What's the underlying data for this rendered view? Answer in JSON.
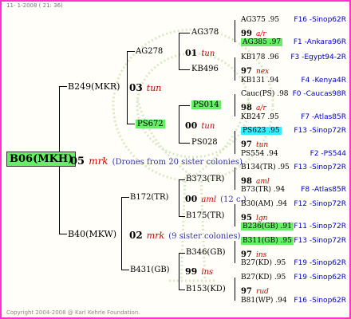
{
  "header": {
    "date": "11- 1-2008 ( 21: 36)"
  },
  "footer": {
    "copyright": "Copyright 2004-2008 @ Karl Kehrle Foundation."
  },
  "root": {
    "name": "B06(MKH)",
    "year": "05",
    "breeder": "mrk",
    "note": "(Drones from 20 sister colonies)"
  },
  "lvl1": {
    "top": {
      "name": "B249(MKR)",
      "year": "03",
      "breeder": "tun"
    },
    "bot": {
      "name": "B40(MKW)",
      "year": "02",
      "breeder": "mrk",
      "note": "(9 sister colonies)"
    }
  },
  "lvl2": {
    "a": {
      "name": "AG278",
      "year": "01",
      "breeder": "tun"
    },
    "b": {
      "name": "PS672",
      "year": "00",
      "breeder": "tun"
    },
    "c": {
      "name": "B172(TR)",
      "year": "00",
      "breeder": "aml",
      "note": "(12 c.)"
    },
    "d": {
      "name": "B431(GB)",
      "year": "99",
      "breeder": "ins"
    }
  },
  "lvl3": {
    "a1": {
      "name": "AG378",
      "year": "99",
      "breeder": "a/r"
    },
    "a2": {
      "name": "KB496",
      "year": "97",
      "breeder": "nex"
    },
    "b1": {
      "name": "PS014",
      "year": "98",
      "breeder": "a/r"
    },
    "b2": {
      "name": "PS028",
      "year": "97",
      "breeder": "tun"
    },
    "c1": {
      "name": "B373(TR)",
      "year": "98",
      "breeder": "aml"
    },
    "c2": {
      "name": "B175(TR)",
      "year": "95",
      "breeder": "lgn"
    },
    "d1": {
      "name": "B346(GB)",
      "year": "97",
      "breeder": "ins"
    },
    "d2": {
      "name": "B153(KD)",
      "year": "97",
      "breeder": "rud"
    }
  },
  "lvl4": [
    {
      "name": "AG375",
      "year": ".95",
      "loc": "F16 -Sinop62R"
    },
    {
      "name": "AG385",
      "year": ".97",
      "loc": "F1 -Ankara96R"
    },
    {
      "name": "KB178",
      "year": ".96",
      "loc": "F3 -Egypt94-2R"
    },
    {
      "name": "KB131",
      "year": ".94",
      "loc": "F4 -Kenya4R"
    },
    {
      "name": "Cauc(PS)",
      "year": ".98",
      "loc": "F0 -Caucas98R"
    },
    {
      "name": "KB247",
      "year": ".95",
      "loc": "F7 -Atlas85R"
    },
    {
      "name": "PS623",
      "year": ".95",
      "loc": "F13 -Sinop72R"
    },
    {
      "name": "PS554",
      "year": ".94",
      "loc": "F2 -PS544"
    },
    {
      "name": "B134(TR)",
      "year": ".95",
      "loc": "F13 -Sinop72R"
    },
    {
      "name": "B73(TR)",
      "year": ".94",
      "loc": "F8 -Atlas85R"
    },
    {
      "name": "B30(AM)",
      "year": ".94",
      "loc": "F12 -Sinop72R"
    },
    {
      "name": "B236(GB)",
      "year": ".91",
      "loc": "F11 -Sinop72R"
    },
    {
      "name": "B311(GB)",
      "year": ".95",
      "loc": "F13 -Sinop72R"
    },
    {
      "name": "B27(KD)",
      "year": ".95",
      "loc": "F19 -Sinop62R"
    },
    {
      "name": "B27(KD)",
      "year": ".95",
      "loc": "F19 -Sinop62R"
    },
    {
      "name": "B81(WP)",
      "year": ".94",
      "loc": "F16 -Sinop62R"
    }
  ],
  "colors": {
    "border": "#ff33cc",
    "highlight_green": "#66ee66",
    "highlight_cyan": "#33eeff",
    "breeder": "#cc0000",
    "location": "#0000cc"
  }
}
